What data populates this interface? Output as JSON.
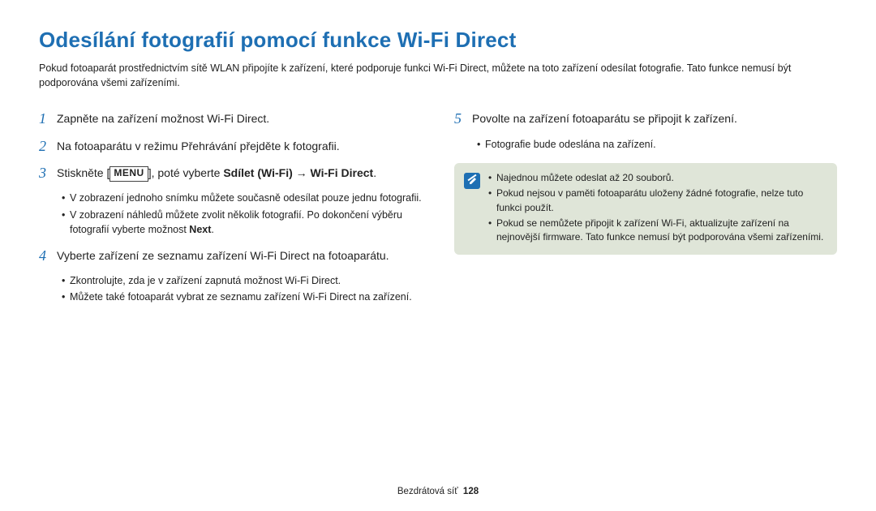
{
  "title": "Odesílání fotografií pomocí funkce Wi-Fi Direct",
  "intro": "Pokud fotoaparát prostřednictvím sítě WLAN připojíte k zařízení, které podporuje funkci Wi-Fi Direct, můžete na toto zařízení odesílat fotografie. Tato funkce nemusí být podporována všemi zařízeními.",
  "left": {
    "s1": {
      "num": "1",
      "text": "Zapněte na zařízení možnost Wi-Fi Direct."
    },
    "s2": {
      "num": "2",
      "text": "Na fotoaparátu v režimu Přehrávání přejděte k fotografii."
    },
    "s3": {
      "num": "3",
      "pre": "Stiskněte [",
      "menu": "MENU",
      "post": "], poté vyberte ",
      "bold": "Sdílet (Wi-Fi) → Wi-Fi Direct",
      "end": ".",
      "subs": {
        "a": "V zobrazení jednoho snímku můžete současně odesílat pouze jednu fotografii.",
        "b_1": "V zobrazení náhledů můžete zvolit několik fotografií. Po dokončení výběru fotografií vyberte možnost ",
        "b_bold": "Next",
        "b_2": "."
      }
    },
    "s4": {
      "num": "4",
      "text": "Vyberte zařízení ze seznamu zařízení Wi-Fi Direct na fotoaparátu.",
      "subs": {
        "a": "Zkontrolujte, zda je v zařízení zapnutá možnost Wi-Fi Direct.",
        "b": "Můžete také fotoaparát vybrat ze seznamu zařízení Wi-Fi Direct na zařízení."
      }
    }
  },
  "right": {
    "s5": {
      "num": "5",
      "text": "Povolte na zařízení fotoaparátu se připojit k zařízení.",
      "subs": {
        "a": "Fotografie bude odeslána na zařízení."
      }
    },
    "note": {
      "a": "Najednou můžete odeslat až 20 souborů.",
      "b": "Pokud nejsou v paměti fotoaparátu uloženy žádné fotografie, nelze tuto funkci použít.",
      "c": "Pokud se nemůžete připojit k zařízení Wi-Fi, aktualizujte zařízení na nejnovější firmware. Tato funkce nemusí být podporována všemi zařízeními."
    }
  },
  "footer": {
    "section": "Bezdrátová síť",
    "page": "128"
  }
}
